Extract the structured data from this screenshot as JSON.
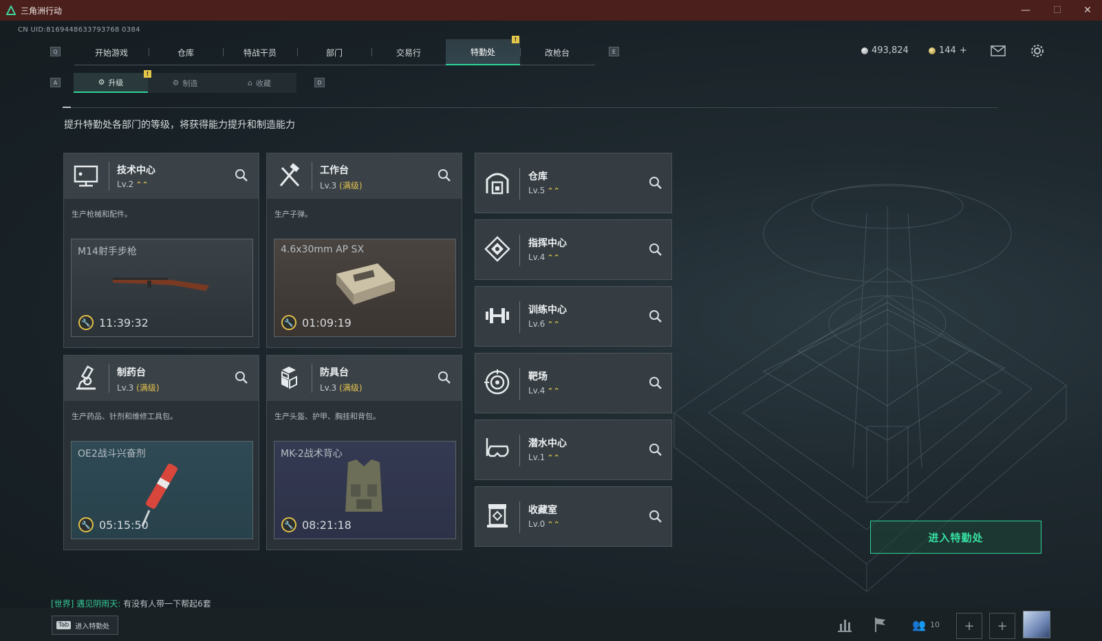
{
  "window": {
    "title": "三角洲行动",
    "controls": [
      "minimize-icon",
      "maximize-icon",
      "close-icon"
    ]
  },
  "uid": "CN UID:8169448633793768 0384",
  "keys": {
    "q": "Q",
    "e": "E",
    "a": "A",
    "d": "D"
  },
  "topnav": {
    "tabs": [
      {
        "label": "开始游戏",
        "active": false
      },
      {
        "label": "仓库",
        "active": false
      },
      {
        "label": "特战干员",
        "active": false
      },
      {
        "label": "部门",
        "active": false
      },
      {
        "label": "交易行",
        "active": false
      },
      {
        "label": "特勤处",
        "active": true
      },
      {
        "label": "改枪台",
        "active": false
      }
    ],
    "warn_mark": "!"
  },
  "currency": {
    "silver": "493,824",
    "gold": "144",
    "gold_plus": "+"
  },
  "subnav": {
    "tabs": [
      {
        "label": "升级",
        "icon": "upgrade-icon",
        "active": true
      },
      {
        "label": "制造",
        "icon": "craft-icon",
        "active": false
      },
      {
        "label": "收藏",
        "icon": "collection-icon",
        "active": false
      }
    ],
    "warn_mark": "!"
  },
  "subtitle": "提升特勤处各部门的等级，将获得能力提升和制造能力",
  "workshops": [
    {
      "name": "技术中心",
      "level": "Lv.2",
      "max": "",
      "desc": "生产枪械和配件。",
      "item": "M14射手步枪",
      "timer": "11:39:32",
      "icon": "computer-icon"
    },
    {
      "name": "工作台",
      "level": "Lv.3",
      "max": "(满级)",
      "desc": "生产子弹。",
      "item": "4.6x30mm AP SX",
      "timer": "01:09:19",
      "icon": "tools-icon"
    },
    {
      "name": "制药台",
      "level": "Lv.3",
      "max": "(满级)",
      "desc": "生产药品、针剂和维修工具包。",
      "item": "OE2战斗兴奋剂",
      "timer": "05:15:50",
      "icon": "microscope-icon"
    },
    {
      "name": "防具台",
      "level": "Lv.3",
      "max": "(满级)",
      "desc": "生产头盔、护甲、胸挂和背包。",
      "item": "MK-2战术背心",
      "timer": "08:21:18",
      "icon": "armor-icon"
    }
  ],
  "facilities": [
    {
      "name": "仓库",
      "level": "Lv.5",
      "icon": "warehouse-icon"
    },
    {
      "name": "指挥中心",
      "level": "Lv.4",
      "icon": "command-icon"
    },
    {
      "name": "训练中心",
      "level": "Lv.6",
      "icon": "dumbbell-icon"
    },
    {
      "name": "靶场",
      "level": "Lv.4",
      "icon": "target-icon"
    },
    {
      "name": "潜水中心",
      "level": "Lv.1",
      "icon": "diving-icon"
    },
    {
      "name": "收藏室",
      "level": "Lv.0",
      "icon": "collection-room-icon"
    }
  ],
  "enter_button": "进入特勤处",
  "chat": {
    "channel": "[世界]",
    "user": "遇见阴雨天:",
    "message": "有没有人带一下帮起6套"
  },
  "bottom": {
    "tab_key": "Tab",
    "tab_hint": "进入特勤处",
    "friends_count": "10"
  }
}
